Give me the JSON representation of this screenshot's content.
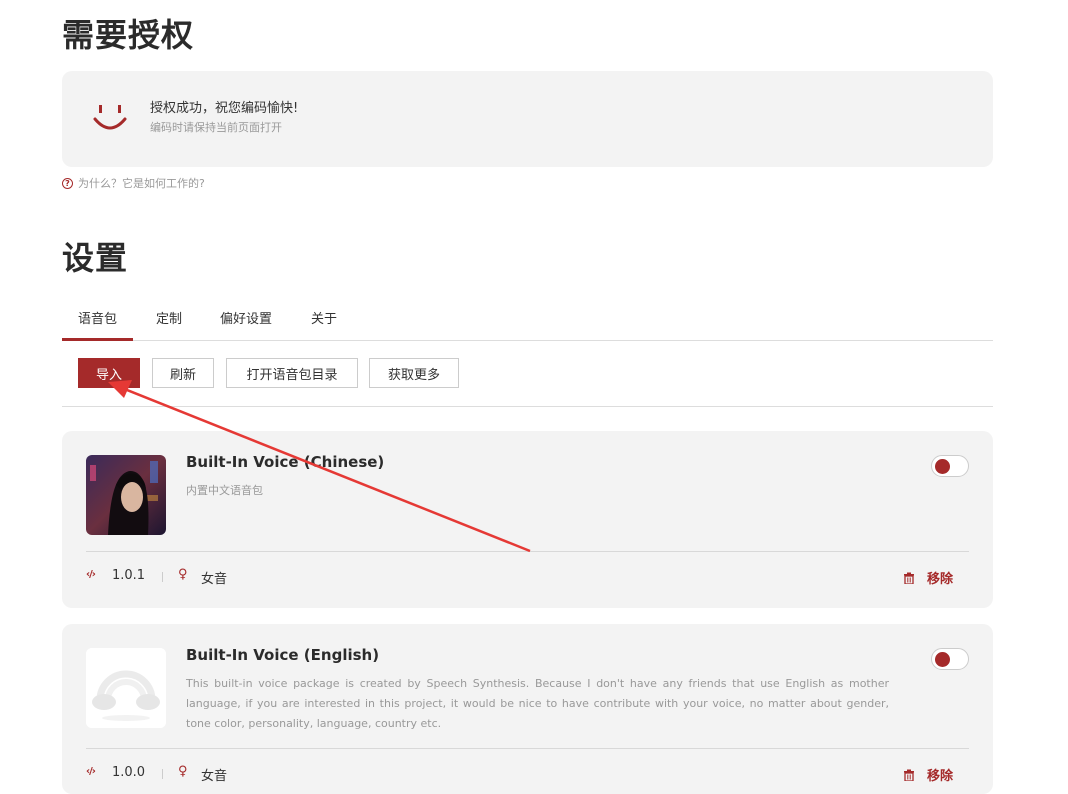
{
  "auth": {
    "title": "需要授权",
    "message": "授权成功，祝您编码愉快!",
    "sub": "编码时请保持当前页面打开",
    "why_link": "为什么？它是如何工作的?"
  },
  "settings": {
    "title": "设置",
    "tabs": [
      {
        "label": "语音包",
        "active": true
      },
      {
        "label": "定制",
        "active": false
      },
      {
        "label": "偏好设置",
        "active": false
      },
      {
        "label": "关于",
        "active": false
      }
    ],
    "buttons": {
      "import": "导入",
      "refresh": "刷新",
      "open_dir": "打开语音包目录",
      "get_more": "获取更多"
    }
  },
  "voices": [
    {
      "title": "Built-In Voice (Chinese)",
      "description": "内置中文语音包",
      "version": "1.0.1",
      "gender": "女音",
      "remove": "移除",
      "enabled": true
    },
    {
      "title": "Built-In Voice (English)",
      "description": "This built-in voice package is created by Speech Synthesis. Because I don't have any friends that use English as mother language, if you are interested in this project, it would be nice to have contribute with your voice, no matter about gender, tone color, personality, language, country etc.",
      "version": "1.0.0",
      "gender": "女音",
      "remove": "移除",
      "enabled": true
    }
  ],
  "colors": {
    "accent": "#a52a2a",
    "card_bg": "#f3f3f3",
    "annotation_arrow": "#e53935"
  },
  "icons": {
    "smile": "smile-icon",
    "help": "question-circle-icon",
    "version": "code-icon",
    "gender": "female-icon",
    "remove": "trash-icon"
  }
}
